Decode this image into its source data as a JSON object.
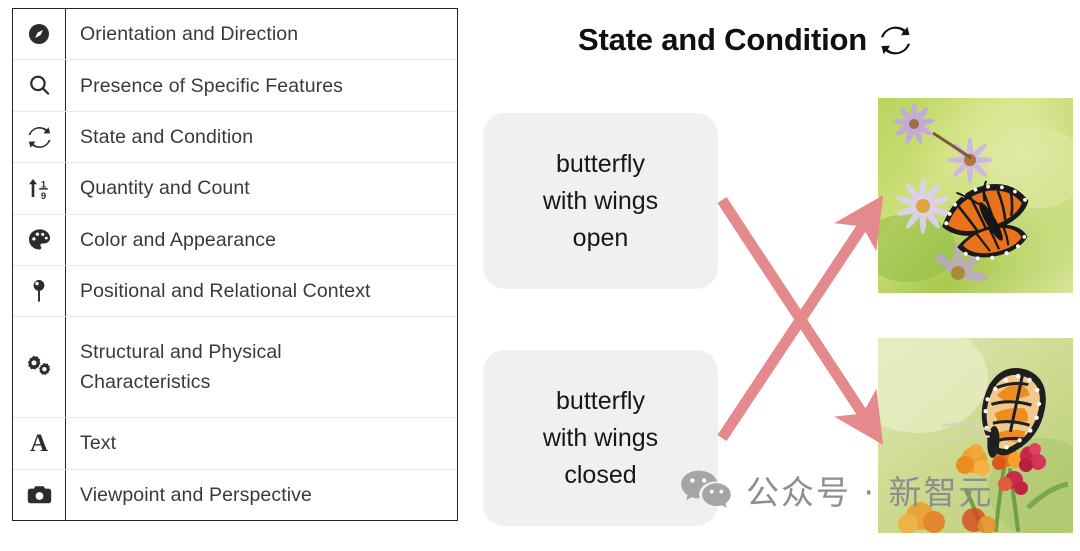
{
  "taxonomy": {
    "rows": [
      {
        "icon": "compass-icon",
        "label": "Orientation and Direction"
      },
      {
        "icon": "magnifier-icon",
        "label": "Presence of Specific Features"
      },
      {
        "icon": "sync-arrows-icon",
        "label": "State and Condition"
      },
      {
        "icon": "sort-numeric-icon",
        "label": "Quantity and Count"
      },
      {
        "icon": "palette-icon",
        "label": "Color and Appearance"
      },
      {
        "icon": "map-pin-icon",
        "label": "Positional and Relational Context"
      },
      {
        "icon": "gears-icon",
        "label": "Structural and Physical Characteristics"
      },
      {
        "icon": "letter-a-icon",
        "label": "Text"
      },
      {
        "icon": "camera-icon",
        "label": "Viewpoint and Perspective"
      }
    ]
  },
  "example": {
    "title": "State and Condition",
    "title_icon": "sync-arrows-icon",
    "captions": [
      {
        "text": "butterfly\nwith wings\nopen",
        "name": "caption-wings-open"
      },
      {
        "text": "butterfly\nwith wings\nclosed",
        "name": "caption-wings-closed"
      }
    ],
    "images": [
      {
        "alt": "monarch butterfly with wings open on purple aster flowers",
        "name": "image-butterfly-wings-open"
      },
      {
        "alt": "monarch butterfly with wings closed on orange milkweed flowers",
        "name": "image-butterfly-wings-closed"
      }
    ],
    "arrow_color": "#e4898c"
  },
  "watermark": {
    "icon": "wechat-icon",
    "text": "公众号 · 新智元",
    "color": "#9a9a9a"
  }
}
